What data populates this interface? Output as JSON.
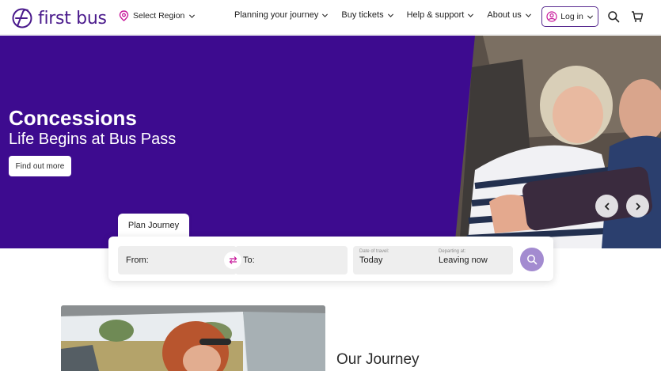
{
  "header": {
    "logo_text": "first bus",
    "region_label": "Select Region",
    "nav": [
      {
        "label": "Planning your journey"
      },
      {
        "label": "Buy tickets"
      },
      {
        "label": "Help & support"
      },
      {
        "label": "About us"
      }
    ],
    "login_label": "Log in",
    "icons": [
      "map-pin-icon",
      "user-icon",
      "search-icon",
      "cart-icon"
    ]
  },
  "hero": {
    "title": "Concessions",
    "subtitle": "Life Begins at Bus Pass",
    "cta_label": "Find out more",
    "colors": {
      "background": "#3d0b8f"
    }
  },
  "planner": {
    "tab_label": "Plan Journey",
    "from_label": "From:",
    "to_label": "To:",
    "date_label": "Date of travel:",
    "date_value": "Today",
    "depart_label": "Departing at:",
    "depart_value": "Leaving now"
  },
  "section": {
    "heading": "Our Journey"
  },
  "colors": {
    "brand": "#4a1a8c",
    "hero": "#3d0b8f",
    "search_button": "#a38bd0"
  }
}
